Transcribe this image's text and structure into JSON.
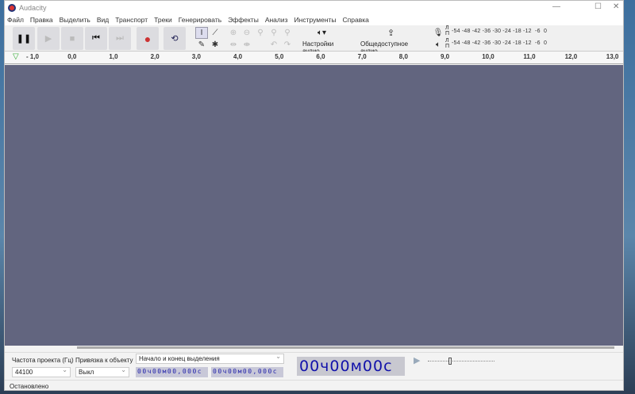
{
  "window": {
    "title": "Audacity"
  },
  "menu": [
    "Файл",
    "Правка",
    "Выделить",
    "Вид",
    "Транспорт",
    "Треки",
    "Генерировать",
    "Эффекты",
    "Анализ",
    "Инструменты",
    "Справка"
  ],
  "toolbar": {
    "audio_setup": "Настройки аудио",
    "share_audio": "Общедоступное аудио",
    "record_meter": "-54 -48 -42 -36 -30 -24 -18 -12  -6  0",
    "play_meter": "-54 -48 -42 -36 -30 -24 -18 -12  -6  0",
    "channel_l": "Л",
    "channel_r": "П"
  },
  "ruler": {
    "ticks": [
      "- 1,0",
      "0,0",
      "1,0",
      "2,0",
      "3,0",
      "4,0",
      "5,0",
      "6,0",
      "7,0",
      "8,0",
      "9,0",
      "10,0",
      "11,0",
      "12,0",
      "13,0"
    ]
  },
  "selection": {
    "rate_label": "Частота проекта (Гц)",
    "rate_value": "44100",
    "snap_label": "Привязка к объекту",
    "snap_value": "Выкл",
    "mode": "Начало и конец выделения",
    "start": "00ч00м00,000с",
    "end": "00ч00м00,000с"
  },
  "time_display": "00ч00м00с",
  "play_speed": {
    "value": 1.0
  },
  "status": "Остановлено"
}
